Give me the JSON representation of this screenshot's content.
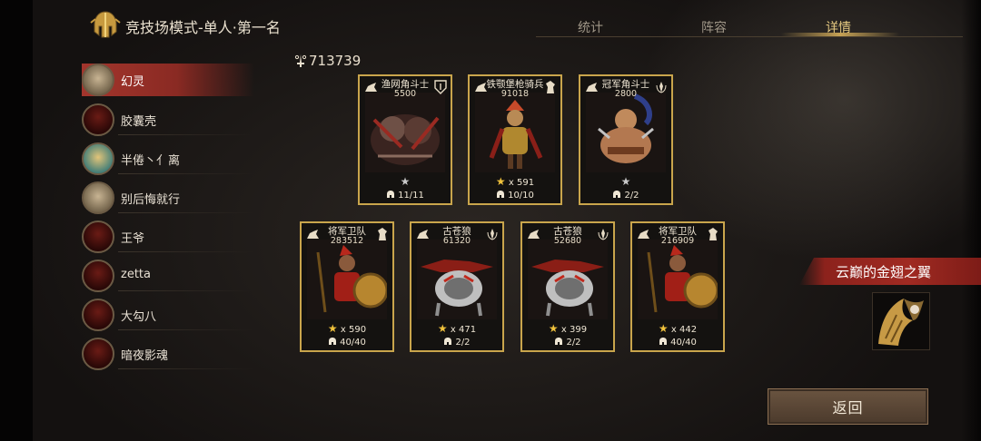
{
  "header": {
    "title": "竞技场模式-单人·第一名",
    "tabs": [
      {
        "label": "统计",
        "active": false
      },
      {
        "label": "阵容",
        "active": false
      },
      {
        "label": "详情",
        "active": true
      }
    ]
  },
  "total_power": "713739",
  "players": [
    {
      "name": "幻灵",
      "avatar": "knight-portrait-icon",
      "active": true
    },
    {
      "name": "胶囊壳",
      "avatar": "demon-portrait-icon",
      "active": false
    },
    {
      "name": "半倦丶亻离",
      "avatar": "golden-hero-portrait-icon",
      "active": false
    },
    {
      "name": "别后悔就行",
      "avatar": "knight-portrait-icon",
      "active": false
    },
    {
      "name": "王爷",
      "avatar": "demon-portrait-icon",
      "active": false
    },
    {
      "name": "zetta",
      "avatar": "demon-portrait-icon",
      "active": false
    },
    {
      "name": "大勾八",
      "avatar": "demon-portrait-icon",
      "active": false
    },
    {
      "name": "暗夜影魂",
      "avatar": "demon-portrait-icon",
      "active": false
    }
  ],
  "units_row1": [
    {
      "name": "渔网角斗士",
      "power": "5500",
      "stars": "",
      "star_color": "grey",
      "count": "11/11",
      "art": "net-gladiator-icon"
    },
    {
      "name": "铁颚堡枪骑兵",
      "power": "91018",
      "stars": "x 591",
      "star_color": "gold",
      "count": "10/10",
      "art": "lancer-icon"
    },
    {
      "name": "冠军角斗士",
      "power": "2800",
      "stars": "",
      "star_color": "grey",
      "count": "2/2",
      "art": "champion-gladiator-icon"
    }
  ],
  "units_row2": [
    {
      "name": "将军卫队",
      "power": "283512",
      "stars": "x 590",
      "star_color": "gold",
      "count": "40/40",
      "art": "general-guard-icon"
    },
    {
      "name": "古苍狼",
      "power": "61320",
      "stars": "x 471",
      "star_color": "gold",
      "count": "2/2",
      "art": "ancient-wolf-icon"
    },
    {
      "name": "古苍狼",
      "power": "52680",
      "stars": "x 399",
      "star_color": "gold",
      "count": "2/2",
      "art": "ancient-wolf-icon"
    },
    {
      "name": "将军卫队",
      "power": "216909",
      "stars": "x 442",
      "star_color": "gold",
      "count": "40/40",
      "art": "general-guard-icon"
    }
  ],
  "wing": {
    "name": "云巅的金翅之翼",
    "icon": "golden-eagle-wing-icon"
  },
  "back_button": "返回",
  "colors": {
    "accent_gold": "#c9a54c",
    "active_red": "#a3352c",
    "tab_active": "#e5c981"
  }
}
